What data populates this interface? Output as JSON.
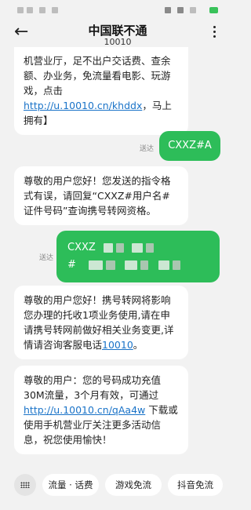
{
  "header": {
    "contact_name": "中国联不通",
    "contact_number": "10010"
  },
  "messages": [
    {
      "direction": "incoming",
      "text_before_link": "机营业厅，足不出户交话费、查余额、办业务，免流量看电影、玩游戏，点击 ",
      "link": "http://u.10010.cn/khddx",
      "text_after_link": "，马上拥有】"
    },
    {
      "direction": "outgoing",
      "status": "送达",
      "text": "CXXZ#A"
    },
    {
      "direction": "incoming",
      "text": "尊敬的用户您好！您发送的指令格式有误，请回复“CXXZ#用户名#证件号码”查询携号转网资格。"
    },
    {
      "direction": "outgoing",
      "status": "送达",
      "line1": "CXXZ",
      "line2": "#"
    },
    {
      "direction": "incoming",
      "text_before_link": "尊敬的用户您好！携号转网将影响您办理的托收1项业务使用,请在申请携号转网前做好相关业务变更,详情请咨询客服电话",
      "link": "10010",
      "text_after_link": "。"
    },
    {
      "direction": "incoming",
      "text_before_link": "尊敬的用户：您的号码成功充值30M流量，3个月有效，可通过",
      "link": "http://u.10010.cn/qAa4w",
      "text_after_link": " 下载或使用手机营业厅关注更多活动信息，祝您使用愉快！"
    }
  ],
  "quick_replies": [
    "流量 · 话费",
    "游戏免流",
    "抖音免流"
  ],
  "colors": {
    "outgoing_bubble": "#2dbd59",
    "incoming_bubble": "#ffffff",
    "link": "#1a73c8",
    "background": "#f2f2f2"
  },
  "icons": {
    "back": "arrow-left-icon",
    "menu": "kebab-menu-icon",
    "keyboard": "keyboard-grid-icon"
  }
}
